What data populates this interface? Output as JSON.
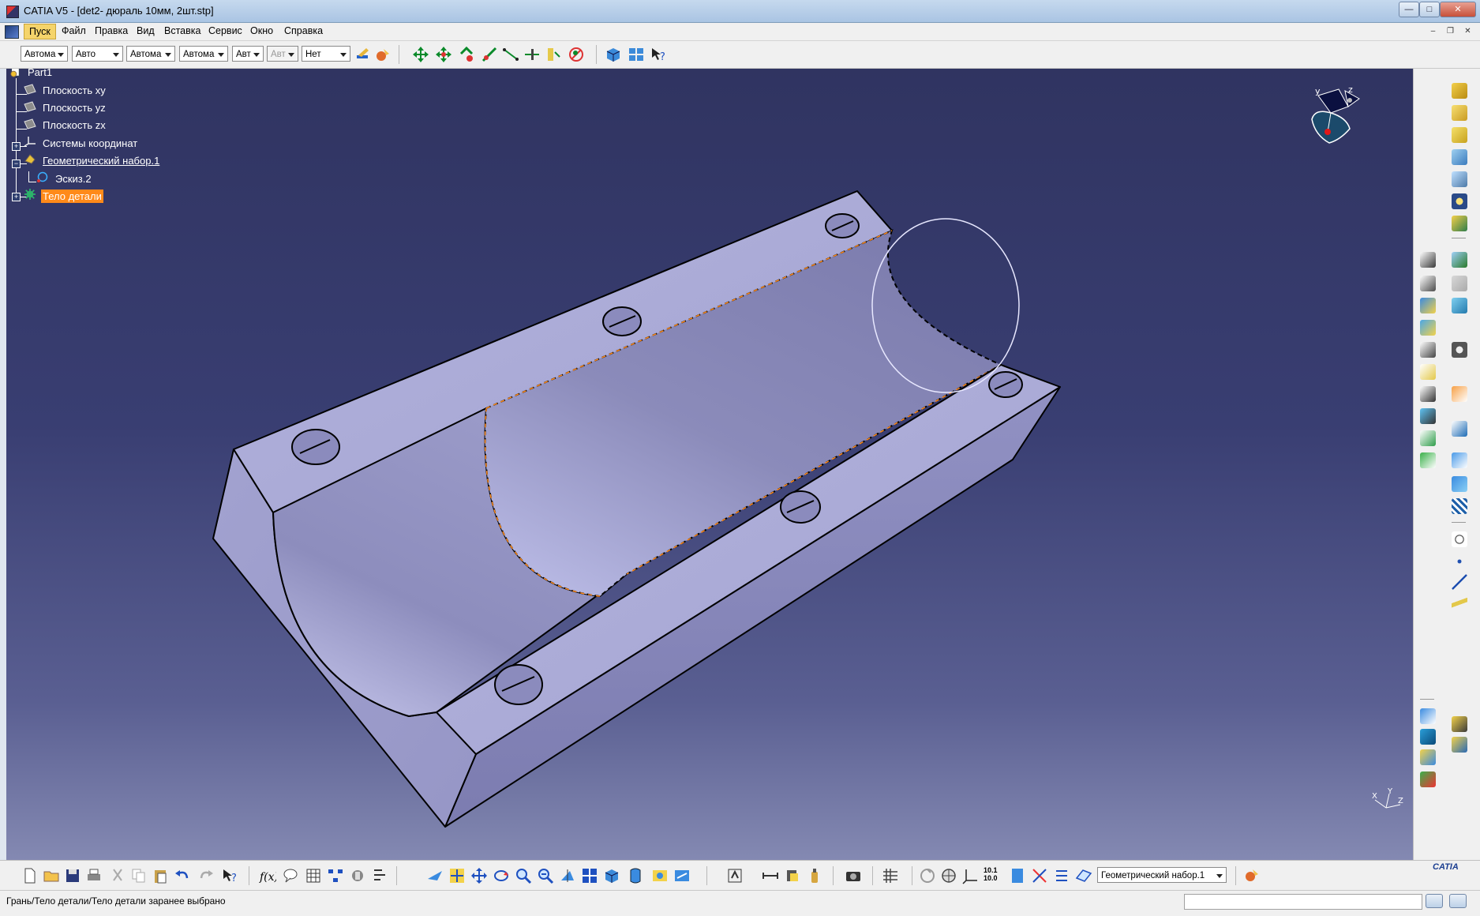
{
  "window": {
    "title": "CATIA V5 - [det2- дюраль 10мм, 2шт.stp]",
    "minimize": "—",
    "maximize": "□",
    "close": "✕"
  },
  "menu": {
    "items": [
      "Пуск",
      "Файл",
      "Правка",
      "Вид",
      "Вставка",
      "Сервис",
      "Окно",
      "Справка"
    ],
    "mdi_minimize": "–",
    "mdi_restore": "❐",
    "mdi_close": "✕"
  },
  "toolbar": {
    "combos": [
      "Автома",
      "Авто",
      "Автома",
      "Автома",
      "Авт",
      "Авт",
      "Нет"
    ]
  },
  "tree": {
    "root": "Part1",
    "items": [
      "Плоскость xy",
      "Плоскость yz",
      "Плоскость zx",
      "Системы координат",
      "Геометрический набор.1",
      "Эскиз.2",
      "Тело детали"
    ]
  },
  "compass": {
    "y_label": "y",
    "z_label": "z"
  },
  "axis_triad": {
    "x_label": "X",
    "y_label": "Y",
    "z_label": "Z"
  },
  "bottom_toolbar": {
    "geom_set_combo": "Геометрический набор.1",
    "measure_label": "10.1 10.0"
  },
  "status": {
    "text": "Грань/Тело детали/Тело детали заранее выбрано"
  },
  "logo": {
    "text": "CATIA"
  },
  "colors": {
    "part_face": "#a9a9d6",
    "selection": "#ff8a1a",
    "viewport_top": "#303461",
    "viewport_bottom": "#8489b2"
  }
}
